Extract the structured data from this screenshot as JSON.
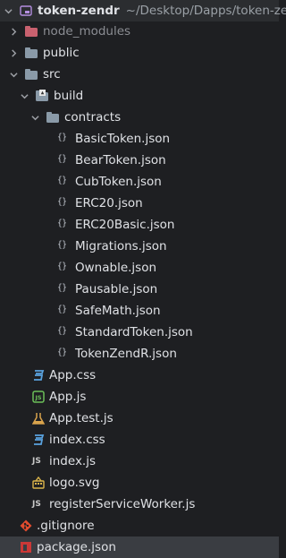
{
  "root": {
    "name": "token-zendr",
    "path": "~/Desktop/Dapps/token-ze"
  },
  "items": [
    {
      "label": "node_modules",
      "type": "folder",
      "expanded": false
    },
    {
      "label": "public",
      "type": "folder",
      "expanded": false
    },
    {
      "label": "src",
      "type": "folder",
      "expanded": true
    },
    {
      "label": "build",
      "type": "folder",
      "expanded": true
    },
    {
      "label": "contracts",
      "type": "folder",
      "expanded": true
    },
    {
      "label": "BasicToken.json",
      "type": "json"
    },
    {
      "label": "BearToken.json",
      "type": "json"
    },
    {
      "label": "CubToken.json",
      "type": "json"
    },
    {
      "label": "ERC20.json",
      "type": "json"
    },
    {
      "label": "ERC20Basic.json",
      "type": "json"
    },
    {
      "label": "Migrations.json",
      "type": "json"
    },
    {
      "label": "Ownable.json",
      "type": "json"
    },
    {
      "label": "Pausable.json",
      "type": "json"
    },
    {
      "label": "SafeMath.json",
      "type": "json"
    },
    {
      "label": "StandardToken.json",
      "type": "json"
    },
    {
      "label": "TokenZendR.json",
      "type": "json"
    },
    {
      "label": "App.css",
      "type": "css"
    },
    {
      "label": "App.js",
      "type": "js-app"
    },
    {
      "label": "App.test.js",
      "type": "js-test"
    },
    {
      "label": "index.css",
      "type": "css"
    },
    {
      "label": "index.js",
      "type": "js"
    },
    {
      "label": "logo.svg",
      "type": "svg"
    },
    {
      "label": "registerServiceWorker.js",
      "type": "js"
    },
    {
      "label": ".gitignore",
      "type": "gitignore"
    },
    {
      "label": "package.json",
      "type": "npm"
    }
  ],
  "icons": {
    "root": "module-folder-icon",
    "folder": "folder-icon",
    "json": "json-file-icon",
    "css": "css-file-icon",
    "js": "js-file-icon",
    "svg": "svg-file-icon",
    "gitignore": "git-icon",
    "npm": "npm-icon"
  },
  "colors": {
    "background": "#1e1f22",
    "selected_row": "#3a3d42",
    "folder_default": "#8a9aa8",
    "folder_excluded": "#c9616f",
    "css": "#3c82c6",
    "js_app": "#6bbf59",
    "test": "#d9a34c",
    "svg": "#d9b34a",
    "git": "#e24c2e"
  }
}
